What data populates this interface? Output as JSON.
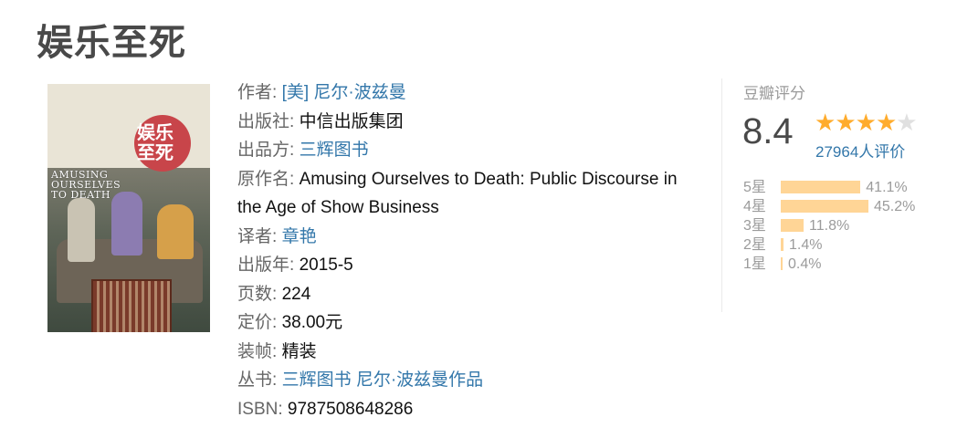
{
  "title": "娱乐至死",
  "cover": {
    "title_cn": "娱乐至死",
    "title_en_lines": [
      "AMUSING",
      "OURSELVES",
      "TO DEATH"
    ]
  },
  "info": [
    {
      "label": "作者: ",
      "values": [
        {
          "text": "[美] 尼尔·波兹曼",
          "link": true
        }
      ]
    },
    {
      "label": "出版社: ",
      "values": [
        {
          "text": "中信出版集团",
          "link": false
        }
      ]
    },
    {
      "label": "出品方: ",
      "values": [
        {
          "text": "三辉图书",
          "link": true
        }
      ]
    },
    {
      "label": "原作名: ",
      "values": [
        {
          "text": "Amusing Ourselves to Death: Public Discourse in",
          "link": false
        }
      ]
    },
    {
      "label": "",
      "values": [
        {
          "text": "the Age of Show Business",
          "link": false
        }
      ]
    },
    {
      "label": "译者: ",
      "values": [
        {
          "text": "章艳",
          "link": true
        }
      ]
    },
    {
      "label": "出版年: ",
      "values": [
        {
          "text": "2015-5",
          "link": false
        }
      ]
    },
    {
      "label": "页数: ",
      "values": [
        {
          "text": "224",
          "link": false
        }
      ]
    },
    {
      "label": "定价: ",
      "values": [
        {
          "text": "38.00元",
          "link": false
        }
      ]
    },
    {
      "label": "装帧: ",
      "values": [
        {
          "text": "精装",
          "link": false
        }
      ]
    },
    {
      "label": "丛书: ",
      "values": [
        {
          "text": "三辉图书 尼尔·波兹曼作品",
          "link": true
        }
      ]
    },
    {
      "label": "ISBN: ",
      "values": [
        {
          "text": "9787508648286",
          "link": false
        }
      ]
    }
  ],
  "rating": {
    "title": "豆瓣评分",
    "score": "8.4",
    "stars_filled": 4,
    "stars_total": 5,
    "votes": "27964人评价",
    "star_color": "#ffac2d",
    "bar_color": "#ffd596",
    "link_color": "#3377aa",
    "breakdown": [
      {
        "label": "5星",
        "percent": 41.1,
        "text": "41.1%"
      },
      {
        "label": "4星",
        "percent": 45.2,
        "text": "45.2%"
      },
      {
        "label": "3星",
        "percent": 11.8,
        "text": "11.8%"
      },
      {
        "label": "2星",
        "percent": 1.4,
        "text": "1.4%"
      },
      {
        "label": "1星",
        "percent": 0.4,
        "text": "0.4%"
      }
    ]
  }
}
